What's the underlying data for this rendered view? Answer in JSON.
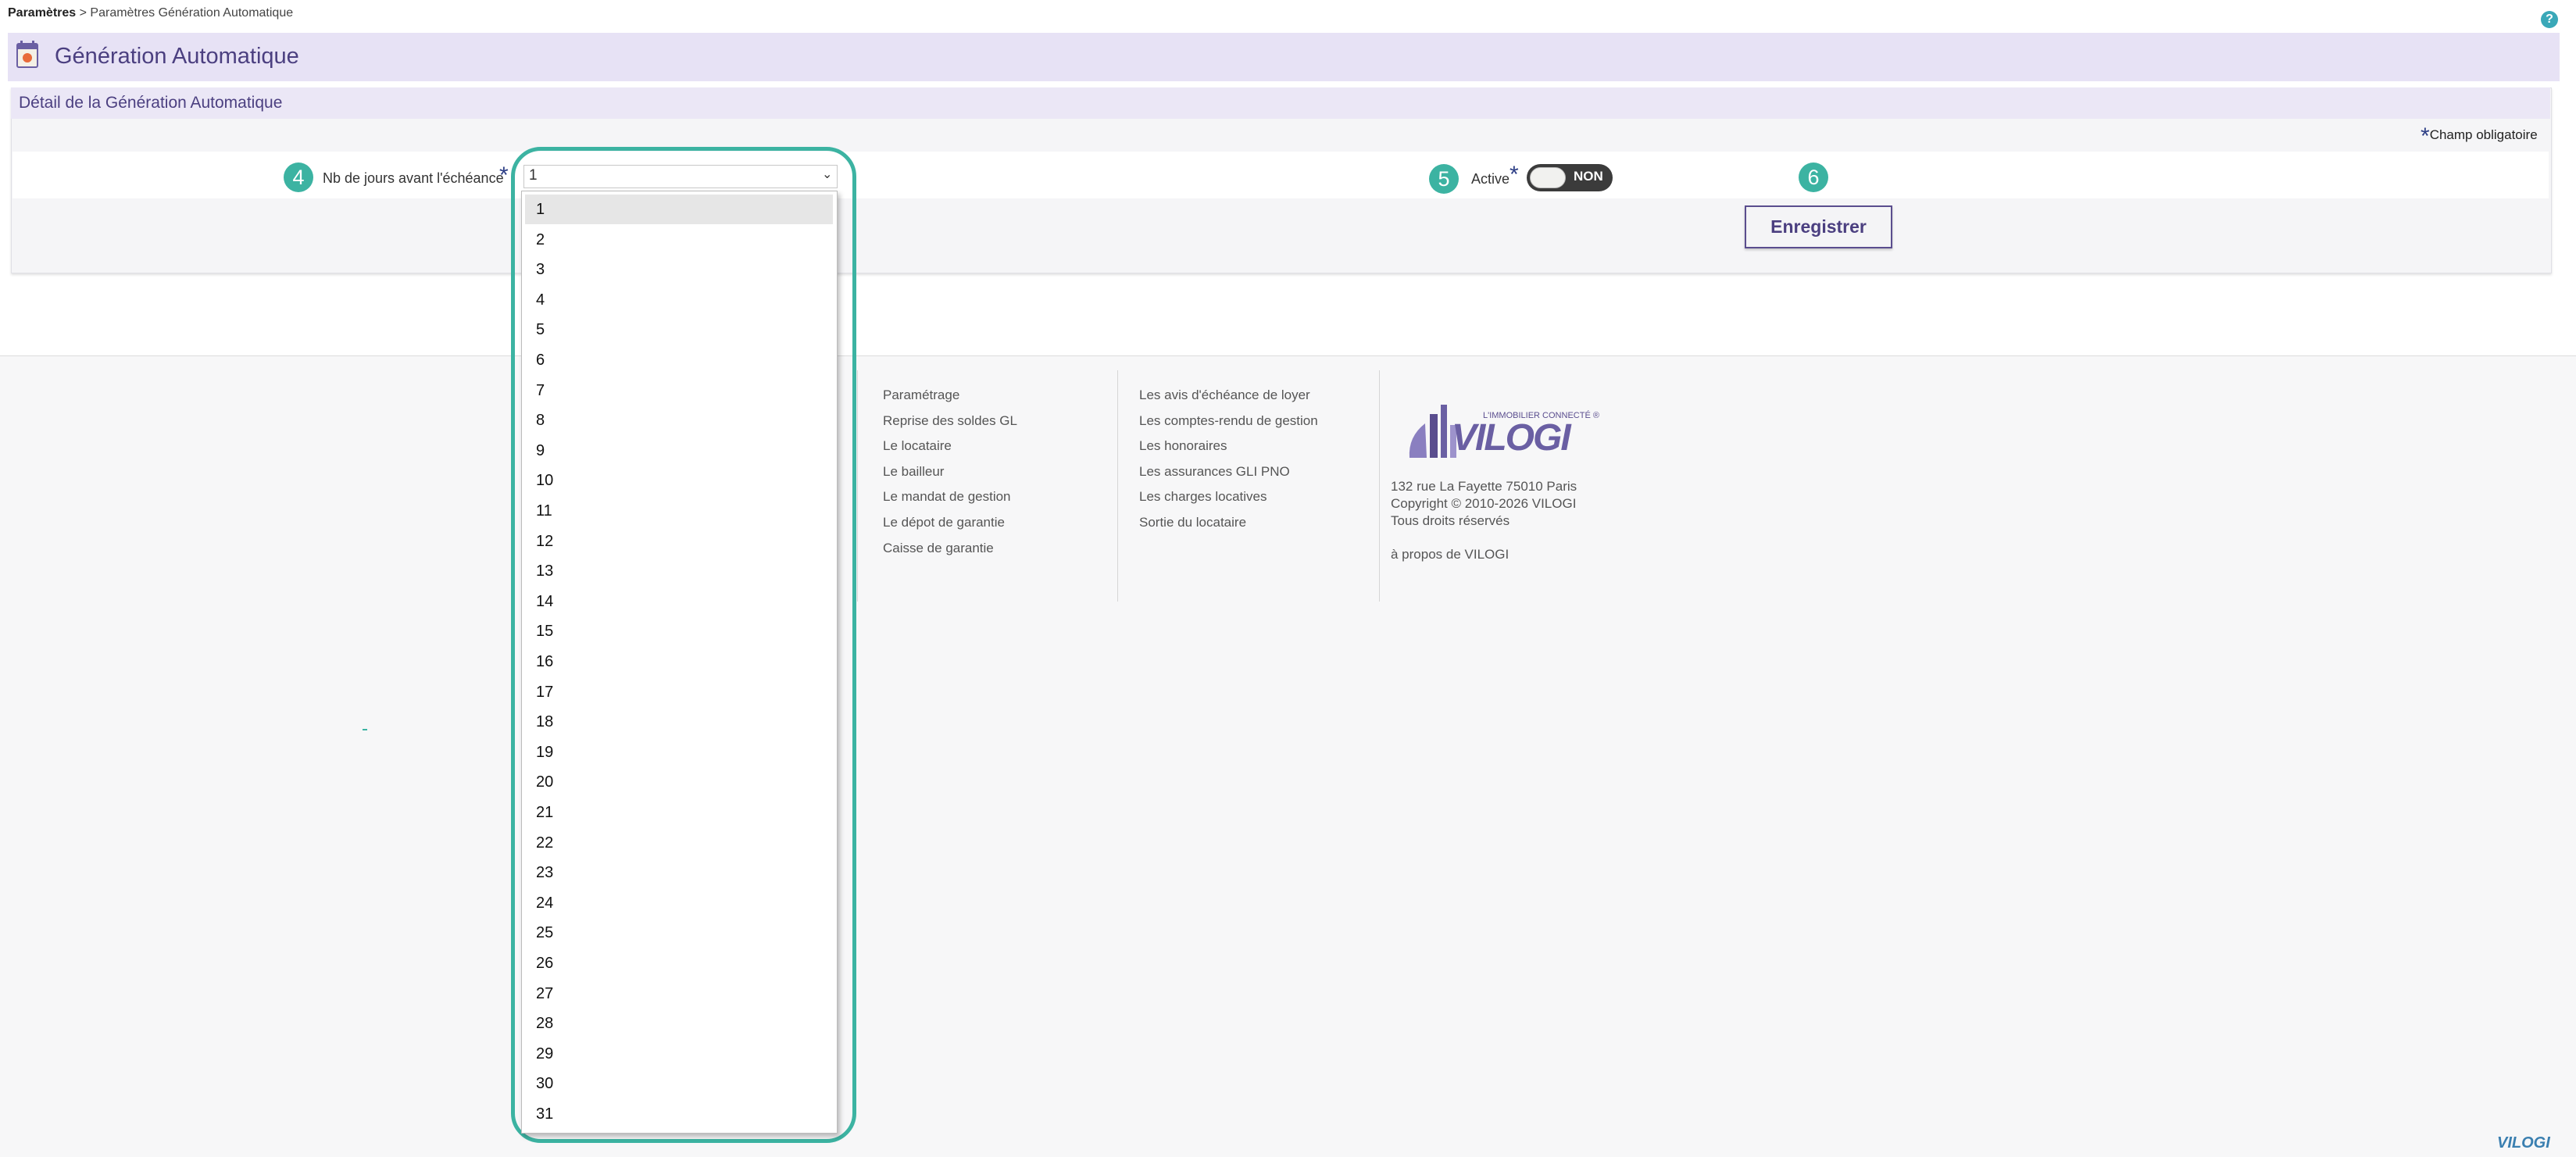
{
  "breadcrumb": {
    "root": "Paramètres",
    "separator": ">",
    "current": "Paramètres Génération Automatique"
  },
  "help": {
    "label": "?"
  },
  "page": {
    "title": "Génération Automatique"
  },
  "panel": {
    "title": "Détail de la Génération Automatique",
    "required_star": "*",
    "required_note": "Champ obligatoire"
  },
  "form": {
    "days_field": {
      "badge": "4",
      "label": "Nb de jours avant l'échéance",
      "star": "*",
      "value": "1",
      "arrow": "⌄"
    },
    "active_field": {
      "badge": "5",
      "label": "Active",
      "star": "*",
      "toggle_text": "NON"
    },
    "save": {
      "badge": "6",
      "label": "Enregistrer"
    }
  },
  "dropdown": {
    "options": [
      "1",
      "2",
      "3",
      "4",
      "5",
      "6",
      "7",
      "8",
      "9",
      "10",
      "11",
      "12",
      "13",
      "14",
      "15",
      "16",
      "17",
      "18",
      "19",
      "20",
      "21",
      "22",
      "23",
      "24",
      "25",
      "26",
      "27",
      "28",
      "29",
      "30",
      "31"
    ],
    "selected": "1"
  },
  "footer": {
    "col1": [
      "Paramétrage",
      "Reprise des soldes GL",
      "Le locataire",
      "Le bailleur",
      "Le mandat de gestion",
      "Le dépot de garantie",
      "Caisse de garantie"
    ],
    "col2": [
      "Les avis d'échéance de loyer",
      "Les comptes-rendu de gestion",
      "Les honoraires",
      "Les assurances GLI PNO",
      "Les charges locatives",
      "Sortie du locataire"
    ],
    "logo": {
      "tagline": "L'IMMOBILIER CONNECTÉ ®",
      "name": "VILOGI"
    },
    "address": "132 rue La Fayette 75010 Paris",
    "copyright": "Copyright © 2010-2026 VILOGI",
    "rights": "Tous droits réservés",
    "about": "à propos de VILOGI",
    "corner_logo": "VILOGI"
  },
  "colors": {
    "accent_teal": "#3cb3a2",
    "brand_purple": "#4b3f80",
    "title_bar": "#e7e2f5"
  }
}
